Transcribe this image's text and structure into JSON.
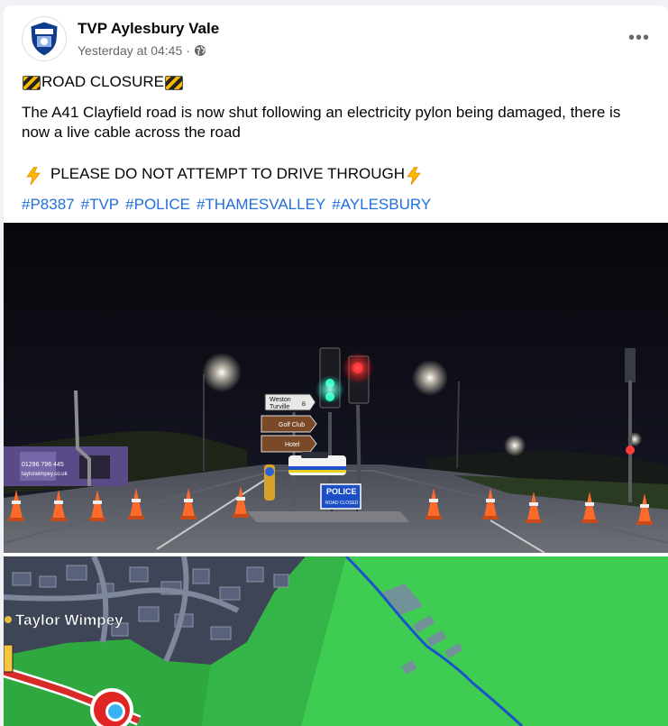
{
  "post": {
    "page_name": "TVP Aylesbury Vale",
    "timestamp": "Yesterday at 04:45",
    "separator": "·",
    "audience_icon": "globe-icon",
    "more_label": "•••",
    "title_text": "ROAD CLOSURE",
    "body_text": "The A41 Clayfield road is now shut following an electricity pylon being damaged, there is now a live cable across the road",
    "warning_text": "PLEASE DO NOT ATTEMPT TO DRIVE THROUGH",
    "hashtags": [
      "#P8387",
      "#TVP",
      "#POLICE",
      "#THAMESVALLEY",
      "#AYLESBURY"
    ]
  },
  "photo1": {
    "signs": {
      "sign1_line1": "Weston",
      "sign1_line2": "Turville",
      "sign1_code": "B",
      "sign2": "Golf Club",
      "sign3": "Hotel",
      "police_sign": "POLICE",
      "police_sign_sub": "ROAD CLOSED",
      "phone": "01296 796 445",
      "site_url": "taylorwimpey.co.uk"
    }
  },
  "photo2": {
    "map_label": "Taylor Wimpey"
  },
  "colors": {
    "hashtag": "#216fdb",
    "secondary_text": "#65676b",
    "map_green": "#3fcc52",
    "map_dark": "#3d4556",
    "traffic_red": "#ff2a2a",
    "traffic_green": "#2dffc0"
  }
}
